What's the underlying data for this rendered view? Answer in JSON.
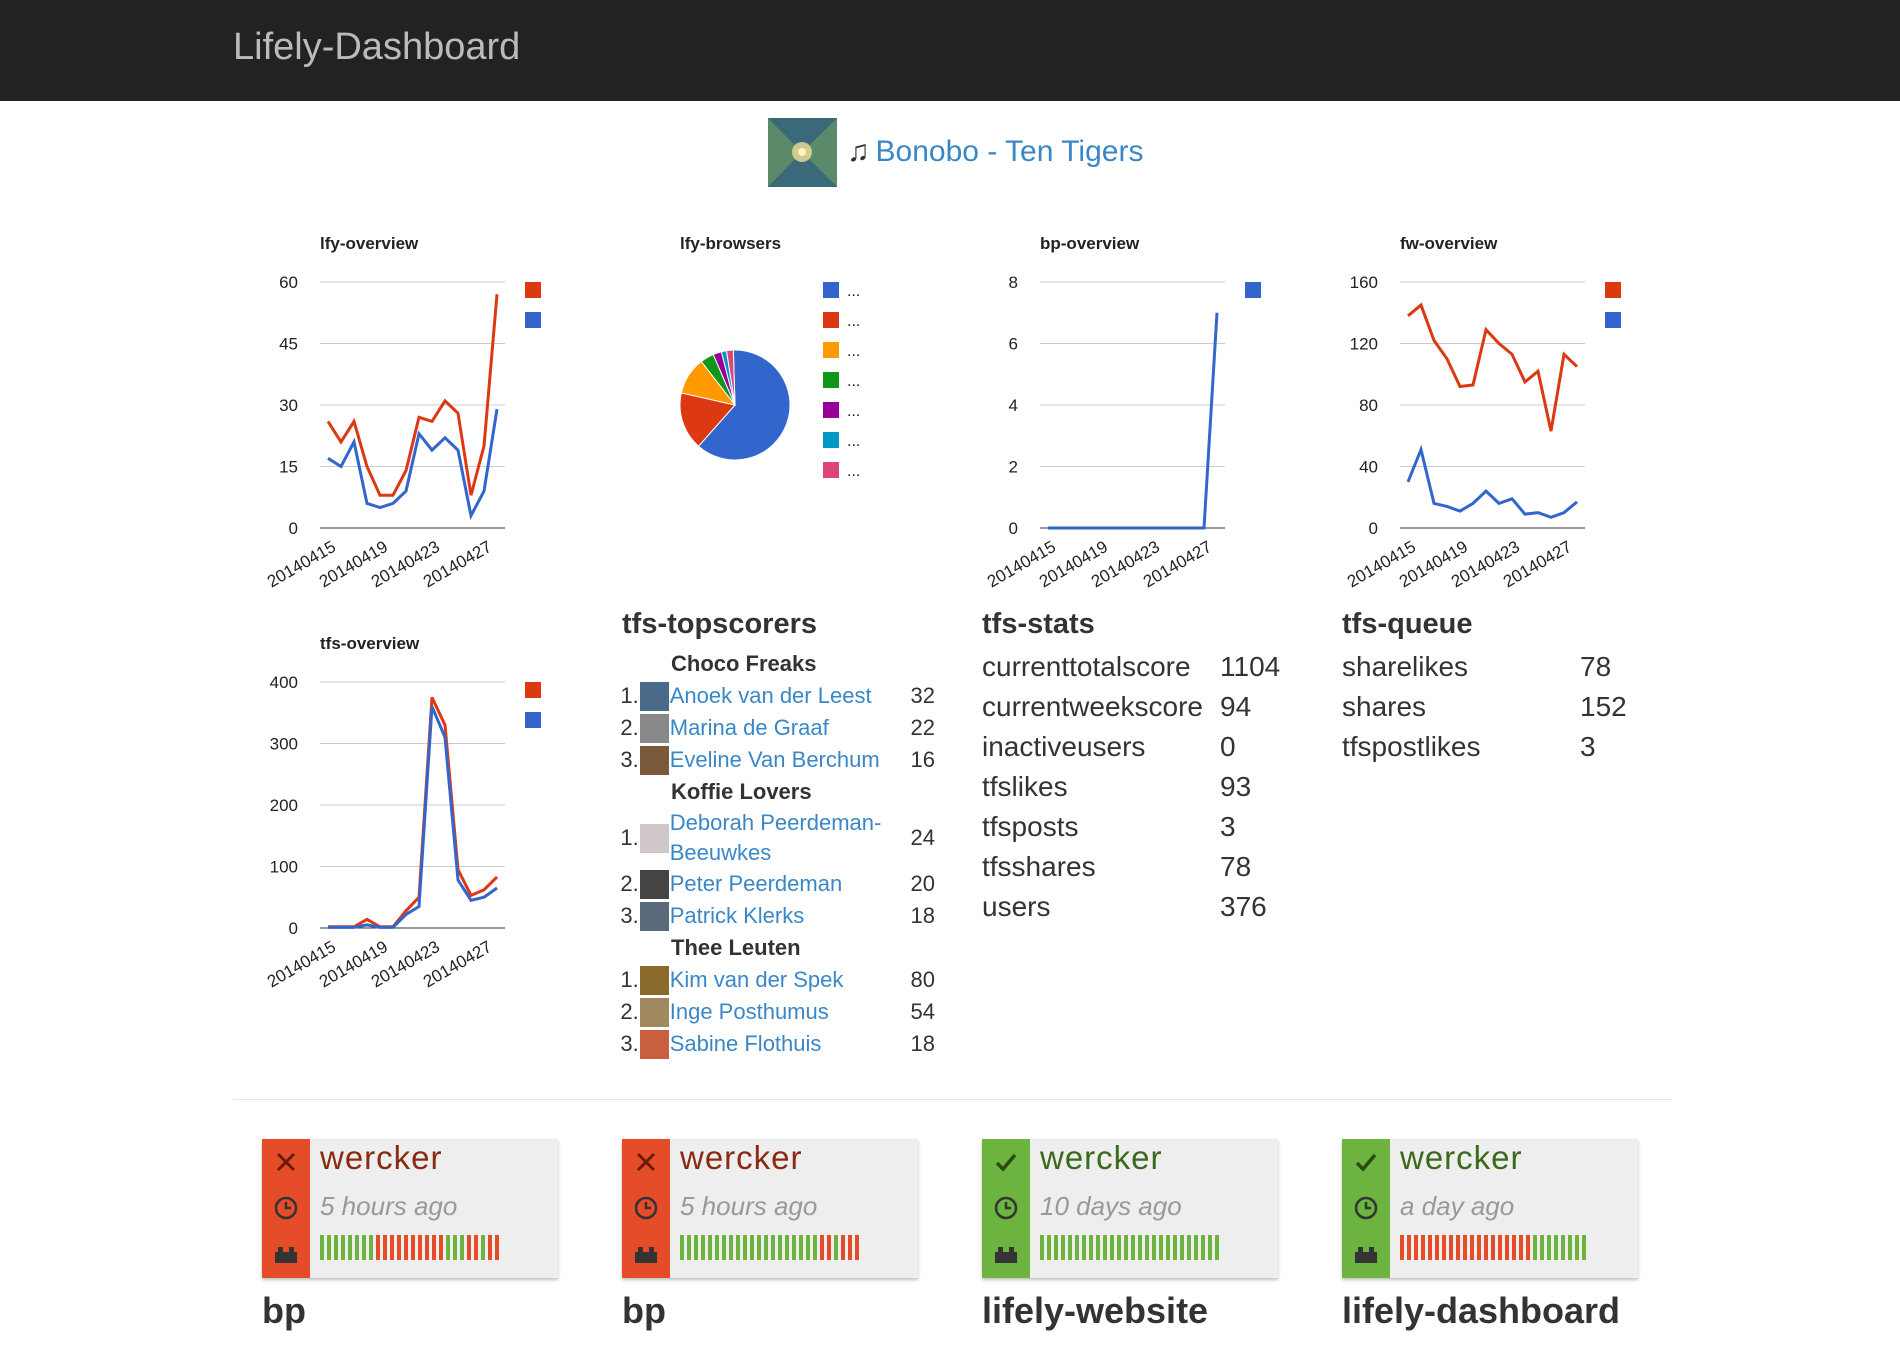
{
  "app": {
    "brand": "Lifely-Dashboard"
  },
  "now_playing": {
    "note": "♫",
    "track": "Bonobo - Ten Tigers"
  },
  "colors": {
    "red": "#dc3912",
    "blue": "#3366cc",
    "link": "#3a87c8",
    "ok": "#6cb33f",
    "fail": "#e54c29"
  },
  "chart_data": [
    {
      "type": "line",
      "title": "lfy-overview",
      "x_ticks": [
        "20140415",
        "20140419",
        "20140423",
        "20140427"
      ],
      "ylim": [
        0,
        60
      ],
      "yticks": [
        "60",
        "45",
        "30",
        "15",
        "0"
      ],
      "series": [
        {
          "color": "#dc3912",
          "values": [
            26,
            21,
            26,
            15,
            8,
            8,
            14,
            27,
            26,
            31,
            28,
            8,
            20,
            57
          ]
        },
        {
          "color": "#3366cc",
          "values": [
            17,
            15,
            21,
            6,
            5,
            6,
            9,
            23,
            19,
            22,
            19,
            3,
            9,
            29
          ]
        }
      ]
    },
    {
      "type": "pie",
      "title": "lfy-browsers",
      "slices": [
        {
          "color": "#3366cc",
          "label": "...",
          "value": 62
        },
        {
          "color": "#dc3912",
          "label": "...",
          "value": 17
        },
        {
          "color": "#ff9900",
          "label": "...",
          "value": 11
        },
        {
          "color": "#109618",
          "label": "...",
          "value": 4
        },
        {
          "color": "#990099",
          "label": "...",
          "value": 2.5
        },
        {
          "color": "#0099c6",
          "label": "...",
          "value": 1.5
        },
        {
          "color": "#dd4477",
          "label": "...",
          "value": 2
        }
      ]
    },
    {
      "type": "line",
      "title": "bp-overview",
      "x_ticks": [
        "20140415",
        "20140419",
        "20140423",
        "20140427"
      ],
      "ylim": [
        0,
        8
      ],
      "yticks": [
        "8",
        "6",
        "4",
        "2",
        "0"
      ],
      "series": [
        {
          "color": "#3366cc",
          "values": [
            0,
            0,
            0,
            0,
            0,
            0,
            0,
            0,
            0,
            0,
            0,
            0,
            0,
            7
          ]
        }
      ]
    },
    {
      "type": "line",
      "title": "fw-overview",
      "x_ticks": [
        "20140415",
        "20140419",
        "20140423",
        "20140427"
      ],
      "ylim": [
        0,
        160
      ],
      "yticks": [
        "160",
        "120",
        "80",
        "40",
        "0"
      ],
      "series": [
        {
          "color": "#dc3912",
          "values": [
            138,
            145,
            122,
            110,
            92,
            93,
            129,
            120,
            113,
            95,
            102,
            63,
            113,
            105
          ]
        },
        {
          "color": "#3366cc",
          "values": [
            30,
            51,
            16,
            14,
            11,
            16,
            24,
            16,
            19,
            9,
            10,
            7,
            10,
            17
          ]
        }
      ]
    },
    {
      "type": "line",
      "title": "tfs-overview",
      "x_ticks": [
        "20140415",
        "20140419",
        "20140423",
        "20140427"
      ],
      "ylim": [
        0,
        400
      ],
      "yticks": [
        "400",
        "300",
        "200",
        "100",
        "0"
      ],
      "series": [
        {
          "color": "#dc3912",
          "values": [
            2,
            2,
            2,
            14,
            2,
            2,
            28,
            50,
            375,
            330,
            95,
            53,
            62,
            83
          ]
        },
        {
          "color": "#3366cc",
          "values": [
            1,
            1,
            1,
            5,
            1,
            1,
            22,
            35,
            360,
            310,
            78,
            45,
            50,
            65
          ]
        }
      ]
    }
  ],
  "topscorers": {
    "title": "tfs-topscorers",
    "teams": [
      {
        "name": "Choco Freaks",
        "players": [
          {
            "rank": "1.",
            "name": "Anoek van der Leest",
            "score": "32",
            "avatar": "#4a6a8a"
          },
          {
            "rank": "2.",
            "name": "Marina de Graaf",
            "score": "22",
            "avatar": "#888888"
          },
          {
            "rank": "3.",
            "name": "Eveline Van Berchum",
            "score": "16",
            "avatar": "#7a5a3a"
          }
        ]
      },
      {
        "name": "Koffie Lovers",
        "players": [
          {
            "rank": "1.",
            "name": "Deborah Peerdeman-Beeuwkes",
            "score": "24",
            "avatar": "#d0c8c8"
          },
          {
            "rank": "2.",
            "name": "Peter Peerdeman",
            "score": "20",
            "avatar": "#444444"
          },
          {
            "rank": "3.",
            "name": "Patrick Klerks",
            "score": "18",
            "avatar": "#5a6a7a"
          }
        ]
      },
      {
        "name": "Thee Leuten",
        "players": [
          {
            "rank": "1.",
            "name": "Kim van der Spek",
            "score": "80",
            "avatar": "#8a6a2a"
          },
          {
            "rank": "2.",
            "name": "Inge Posthumus",
            "score": "54",
            "avatar": "#a08860"
          },
          {
            "rank": "3.",
            "name": "Sabine Flothuis",
            "score": "18",
            "avatar": "#c86040"
          }
        ]
      }
    ]
  },
  "tfs_stats": {
    "title": "tfs-stats",
    "rows": [
      {
        "key": "currenttotalscore",
        "value": "1104"
      },
      {
        "key": "currentweekscore",
        "value": "94"
      },
      {
        "key": "inactiveusers",
        "value": "0"
      },
      {
        "key": "tfslikes",
        "value": "93"
      },
      {
        "key": "tfsposts",
        "value": "3"
      },
      {
        "key": "tfsshares",
        "value": "78"
      },
      {
        "key": "users",
        "value": "376"
      }
    ]
  },
  "tfs_queue": {
    "title": "tfs-queue",
    "rows": [
      {
        "key": "sharelikes",
        "value": "78"
      },
      {
        "key": "shares",
        "value": "152"
      },
      {
        "key": "tfspostlikes",
        "value": "3"
      }
    ]
  },
  "builds": [
    {
      "label": "wercker",
      "when": "5 hours ago",
      "status": "failed",
      "project": "bp",
      "history": "ggggggggrrrrrrrrrrgggrrgrr"
    },
    {
      "label": "wercker",
      "when": "5 hours ago",
      "status": "failed",
      "project": "bp",
      "history": "ggggggggggggggggggggrrgrrr"
    },
    {
      "label": "wercker",
      "when": "10 days ago",
      "status": "passed",
      "project": "lifely-website",
      "history": "gggggggggggggggggggggggggg"
    },
    {
      "label": "wercker",
      "when": "a day ago",
      "status": "passed",
      "project": "lifely-dashboard",
      "history": "rrrrrrrrrrrrrrrrrrrgggggggg"
    }
  ]
}
